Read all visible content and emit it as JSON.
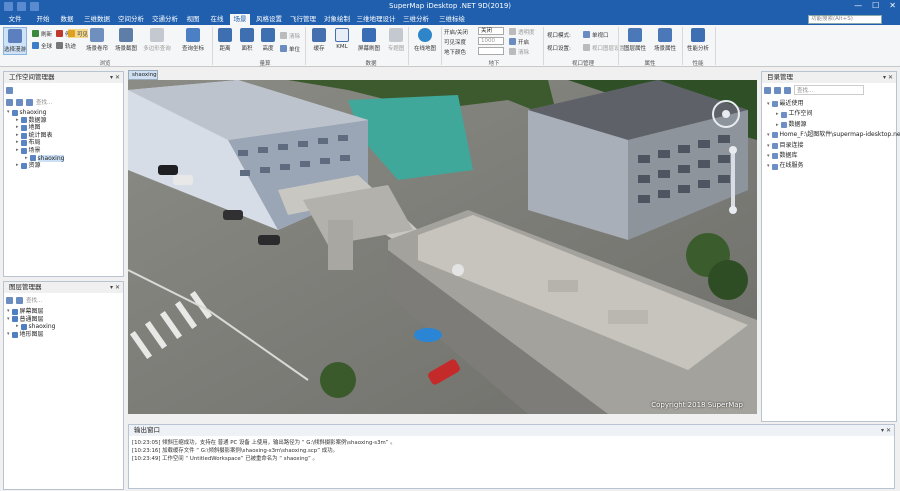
{
  "app": {
    "title": "SuperMap iDesktop .NET 9D(2019)"
  },
  "ribbon": {
    "tabs": [
      "文件",
      "开始",
      "数据",
      "三维数据",
      "空间分析",
      "交通分析",
      "视图",
      "在线",
      "场景",
      "风格设置",
      "飞行管理",
      "对象绘制",
      "三维地理设计",
      "三维分析",
      "三维标绘"
    ],
    "active_tab": "场景",
    "search_placeholder": "功能搜索(Alt+S)",
    "browse": {
      "select_label": "选择漫游",
      "refresh_label": "刷新",
      "stop_label": "停止",
      "visible_label": "可见",
      "fullscreen_label": "全球",
      "track_label": "轨迹",
      "scene_album_label": "场景卷帘",
      "scene_clip_label": "场景截图",
      "multi_query_label": "多边形查询",
      "query_coord_label": "查询坐标",
      "group_label": "浏览"
    },
    "measure": {
      "distance_label": "距离",
      "area_label": "面积",
      "height_label": "高度",
      "clear_label": "清除",
      "unit_label": "单位",
      "group_label": "量算"
    },
    "data": {
      "cache_label": "缓存",
      "kml_label": "KML",
      "screen_label": "屏幕刷图",
      "thematic_label": "专题图",
      "group_label": "数据"
    },
    "online": {
      "online_map_label": "在线地图"
    },
    "underground": {
      "open_label": "开启/关闭",
      "depth_label": "可见深度",
      "color_label": "地下颜色",
      "combo_value": "关闭",
      "depth_value": "1000",
      "opacity_label": "透明度",
      "open_toggle_label": "开启",
      "clear_label": "清除",
      "group_label": "地下"
    },
    "viewport": {
      "mode_label": "视口模式:",
      "mode_value": "单视口",
      "settings_label": "视口设置:",
      "settings_value": "视口图层设置...",
      "group_label": "视口管理"
    },
    "props": {
      "layer_prop_label": "图层属性",
      "scene_prop_label": "场景属性",
      "group_label": "属性"
    },
    "perf": {
      "analysis_label": "性能分析",
      "group_label": "性能"
    }
  },
  "workspace_panel": {
    "title": "工作空间管理器",
    "search_placeholder": "查找...",
    "tree": [
      {
        "label": "shaoxing",
        "level": 0
      },
      {
        "label": "数据源",
        "level": 1
      },
      {
        "label": "地图",
        "level": 1
      },
      {
        "label": "统计图表",
        "level": 1
      },
      {
        "label": "布局",
        "level": 1
      },
      {
        "label": "场景",
        "level": 1
      },
      {
        "label": "shaoxing",
        "level": 2,
        "selected": true
      },
      {
        "label": "资源",
        "level": 1
      }
    ]
  },
  "layer_panel": {
    "title": "图层管理器",
    "search_placeholder": "查找...",
    "tree": [
      {
        "label": "屏幕图层",
        "level": 0
      },
      {
        "label": "普通图层",
        "level": 0
      },
      {
        "label": "shaoxing",
        "level": 1
      },
      {
        "label": "地形图层",
        "level": 0
      }
    ]
  },
  "catalog_panel": {
    "title": "目录管理",
    "search_placeholder": "查找...",
    "tree": [
      {
        "label": "最近使用",
        "level": 0
      },
      {
        "label": "工作空间",
        "level": 1
      },
      {
        "label": "数据源",
        "level": 1
      },
      {
        "label": "Home_F:\\超图软件\\supermap-idesktop.net...",
        "level": 0
      },
      {
        "label": "目录连接",
        "level": 0
      },
      {
        "label": "数据库",
        "level": 0
      },
      {
        "label": "在线服务",
        "level": 0
      }
    ]
  },
  "scene": {
    "tab_label": "shaoxing",
    "copyright": "Copyright 2018 SuperMap"
  },
  "output": {
    "title": "输出窗口",
    "lines": [
      "[10:23:05] 倾斜压缩成功，支持在 普通 PC 设备 上使用，输出路径为 “ G:\\倾斜摄影案例\\shaoxing-s3m” 。",
      "[10:23:16] 加载缓存文件 “ G:\\倾斜摄影案例\\shaoxing-s3m\\shaoxing.scp” 成功。",
      "[10:23:49] 工作空间 “ UntitledWorkspace” 已被重命名为 “ shaoxing” 。"
    ]
  },
  "colors": {
    "titlebar": "#1f5fae",
    "ribbon_bg": "#f5f6f7",
    "selection": "#cce0f7"
  }
}
